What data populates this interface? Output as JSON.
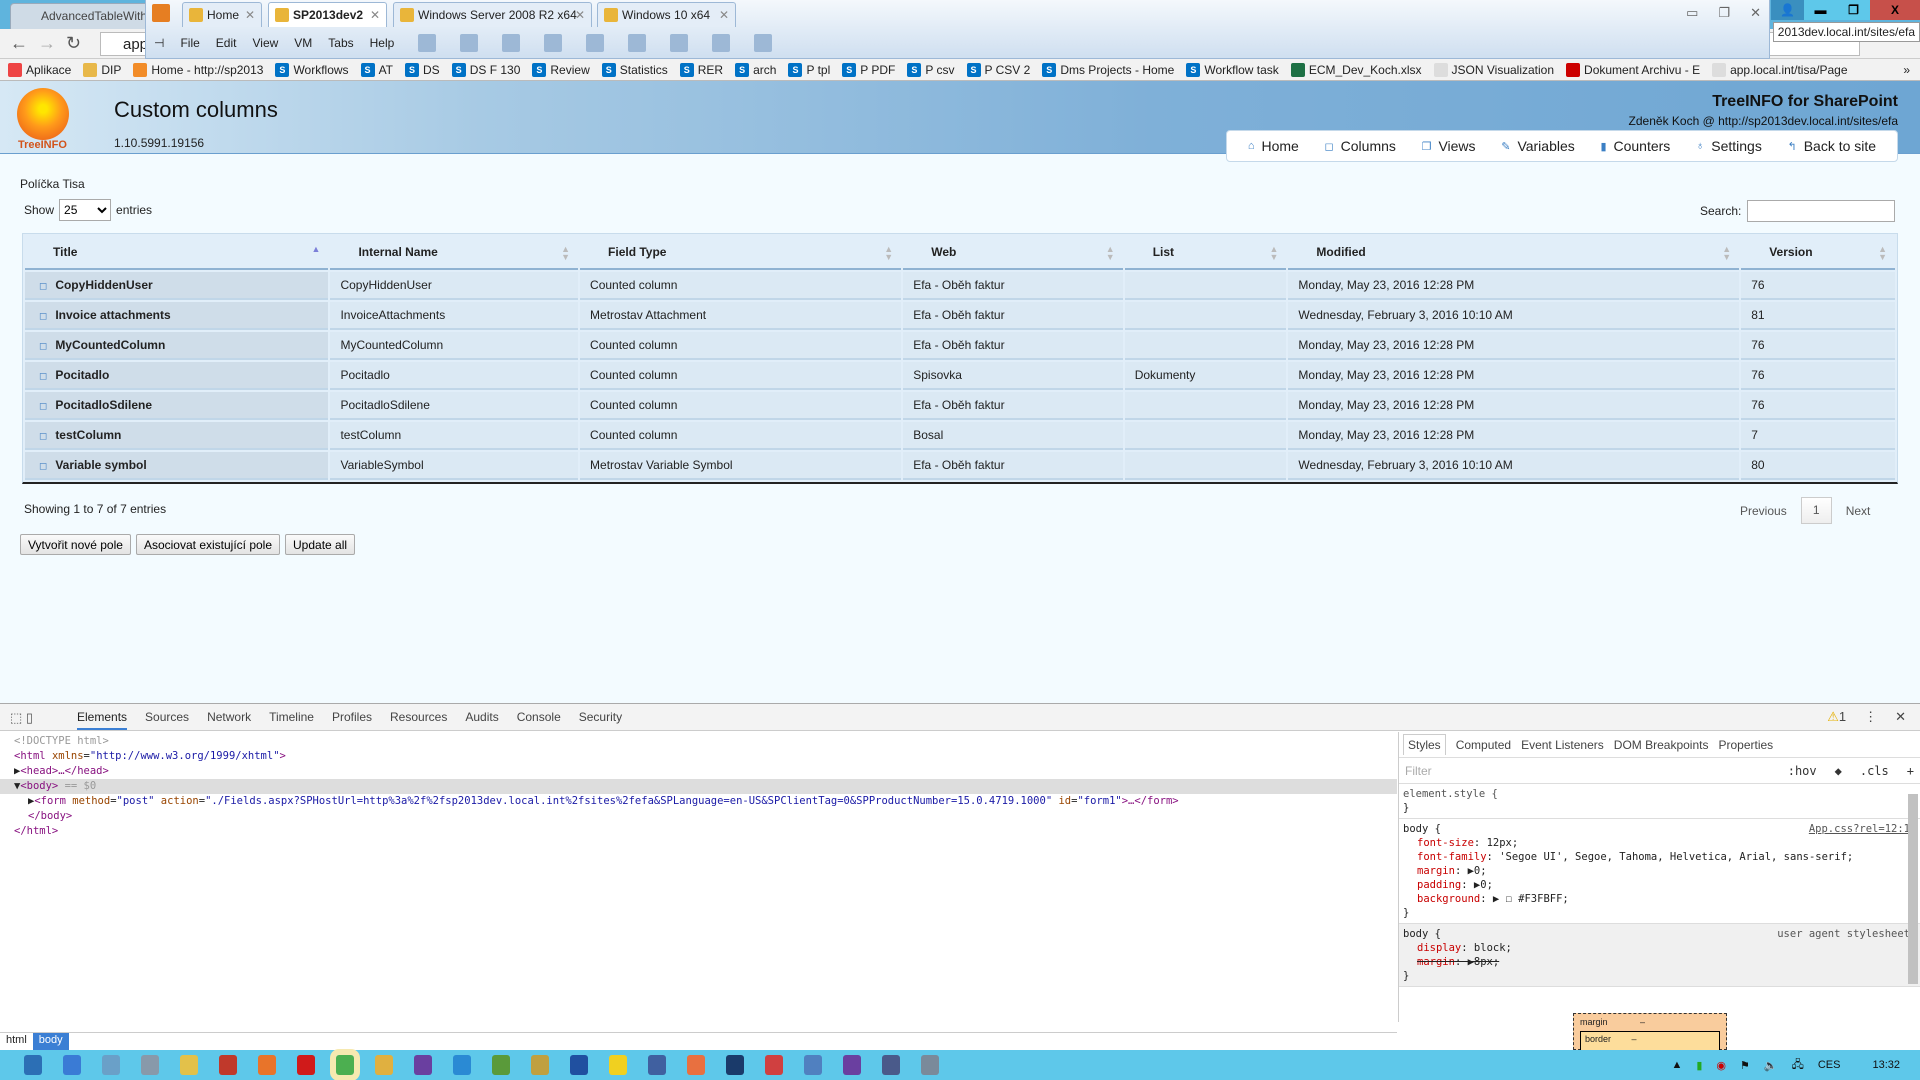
{
  "browser": {
    "tab_title": "AdvancedTableWith",
    "address": "app",
    "tooltip": "2013dev.local.int/sites/efa",
    "bookmarks": [
      "Aplikace",
      "DIP",
      "Home - http://sp2013",
      "Workflows",
      "AT",
      "DS",
      "DS F 130",
      "Review",
      "Statistics",
      "RER",
      "arch",
      "P tpl",
      "P PDF",
      "P csv",
      "P CSV 2",
      "Dms Projects - Home",
      "Workflow task",
      "ECM_Dev_Koch.xlsx",
      "JSON Visualization",
      "Dokument Archivu - E",
      "app.local.int/tisa/Page"
    ],
    "more": "»"
  },
  "vmware": {
    "tabs": [
      {
        "label": "Home",
        "active": false
      },
      {
        "label": "SP2013dev2",
        "active": true
      },
      {
        "label": "Windows Server 2008 R2 x64",
        "active": false
      },
      {
        "label": "Windows 10 x64",
        "active": false
      }
    ],
    "menu": [
      "File",
      "Edit",
      "View",
      "VM",
      "Tabs",
      "Help"
    ]
  },
  "header": {
    "logo_text": "TreeINFO",
    "title": "Custom columns",
    "version": "1.10.5991.19156",
    "brand": "TreeINFO for SharePoint",
    "user": "Zdeněk Koch @ http://sp2013dev.local.int/sites/efa",
    "nav": [
      {
        "label": "Home",
        "icon": "home-icon",
        "glyph": "⌂"
      },
      {
        "label": "Columns",
        "icon": "column-icon",
        "glyph": "◻"
      },
      {
        "label": "Views",
        "icon": "views-icon",
        "glyph": "❐"
      },
      {
        "label": "Variables",
        "icon": "pencil-icon",
        "glyph": "✎"
      },
      {
        "label": "Counters",
        "icon": "counter-icon",
        "glyph": "▮"
      },
      {
        "label": "Settings",
        "icon": "lightbulb-icon",
        "glyph": "♁"
      },
      {
        "label": "Back to site",
        "icon": "back-arrow-icon",
        "glyph": "↰"
      }
    ]
  },
  "content": {
    "subtitle": "Políčka Tisa",
    "show_label": "Show",
    "entries_value": "25",
    "entries_label": "entries",
    "search_label": "Search:",
    "search_value": "",
    "columns": [
      "Title",
      "Internal Name",
      "Field Type",
      "Web",
      "List",
      "Modified",
      "Version"
    ],
    "sorted_column": "Title",
    "rows": [
      [
        "CopyHiddenUser",
        "CopyHiddenUser",
        "Counted column",
        "Efa - Oběh faktur",
        "",
        "Monday, May 23, 2016 12:28 PM",
        "76"
      ],
      [
        "Invoice attachments",
        "InvoiceAttachments",
        "Metrostav Attachment",
        "Efa - Oběh faktur",
        "",
        "Wednesday, February 3, 2016 10:10 AM",
        "81"
      ],
      [
        "MyCountedColumn",
        "MyCountedColumn",
        "Counted column",
        "Efa - Oběh faktur",
        "",
        "Monday, May 23, 2016 12:28 PM",
        "76"
      ],
      [
        "Pocitadlo",
        "Pocitadlo",
        "Counted column",
        "Spisovka",
        "Dokumenty",
        "Monday, May 23, 2016 12:28 PM",
        "76"
      ],
      [
        "PocitadloSdilene",
        "PocitadloSdilene",
        "Counted column",
        "Efa - Oběh faktur",
        "",
        "Monday, May 23, 2016 12:28 PM",
        "76"
      ],
      [
        "testColumn",
        "testColumn",
        "Counted column",
        "Bosal",
        "",
        "Monday, May 23, 2016 12:28 PM",
        "7"
      ],
      [
        "Variable symbol",
        "VariableSymbol",
        "Metrostav Variable Symbol",
        "Efa - Oběh faktur",
        "",
        "Wednesday, February 3, 2016 10:10 AM",
        "80"
      ]
    ],
    "info": "Showing 1 to 7 of 7 entries",
    "pager": {
      "previous": "Previous",
      "page": "1",
      "next": "Next"
    },
    "buttons": [
      "Vytvořit nové pole",
      "Asociovat existující pole",
      "Update all"
    ]
  },
  "devtools": {
    "tabs": [
      "Elements",
      "Sources",
      "Network",
      "Timeline",
      "Profiles",
      "Resources",
      "Audits",
      "Console",
      "Security"
    ],
    "active_tab": "Elements",
    "warnings": "1",
    "dom": {
      "doctype": "<!DOCTYPE html>",
      "html_open": "<html",
      "xmlns_attr": "xmlns",
      "xmlns_val": "\"http://www.w3.org/1999/xhtml\"",
      "head": "<head>…</head>",
      "body": "<body>",
      "body_sel": "== $0",
      "form_tag": "<form",
      "form_method": "method",
      "form_method_val": "\"post\"",
      "form_action": "action",
      "form_action_val": "\"./Fields.aspx?SPHostUrl=http%3a%2f%2fsp2013dev.local.int%2fsites%2fefa&SPLanguage=en-US&SPClientTag=0&SPProductNumber=15.0.4719.1000\"",
      "form_id": "id",
      "form_id_val": "\"form1\"",
      "form_close": ">…</form>",
      "body_close": "</body>",
      "html_close": "</html>"
    },
    "style_tabs": [
      "Styles",
      "Computed",
      "Event Listeners",
      "DOM Breakpoints",
      "Properties"
    ],
    "filter_placeholder": "Filter",
    "filter_tools": [
      ":hov",
      ".cls",
      "+"
    ],
    "rules": {
      "element_style": "element.style {",
      "close": "}",
      "body_sel": "body {",
      "body_src": "App.css?rel=12:1",
      "props": [
        {
          "name": "font-size",
          "value": "12px;"
        },
        {
          "name": "font-family",
          "value": "'Segoe UI', Segoe, Tahoma, Helvetica, Arial, sans-serif;"
        },
        {
          "name": "margin",
          "value": "▶0;"
        },
        {
          "name": "padding",
          "value": "▶0;"
        },
        {
          "name": "background",
          "value": "▶ ☐ #F3FBFF;"
        }
      ],
      "ua_src": "user agent stylesheet",
      "ua_props": [
        {
          "name": "display",
          "value": "block;"
        },
        {
          "name": "margin",
          "value": "▶8px;"
        }
      ]
    },
    "boxmodel": {
      "margin": "margin",
      "border": "border",
      "dash": "–"
    },
    "breadcrumbs": [
      "html",
      "body"
    ]
  },
  "taskbar": {
    "icons": [
      "#2c6fb5",
      "#3a7bd5",
      "#6aa0c8",
      "#8899aa",
      "#e3c14a",
      "#c0392b",
      "#e8742a",
      "#d01a1a",
      "#4caf50",
      "#e0b040",
      "#6a3fa0",
      "#2a8ad4",
      "#5a9a3a",
      "#c0a040",
      "#2050a0",
      "#f0d020",
      "#4060a0",
      "#e87040",
      "#1a3a6a",
      "#d04040",
      "#5080c0",
      "#6a3fa0",
      "#4a5a8a",
      "#7a8a9a"
    ],
    "language": "CES",
    "time": "13:32"
  }
}
